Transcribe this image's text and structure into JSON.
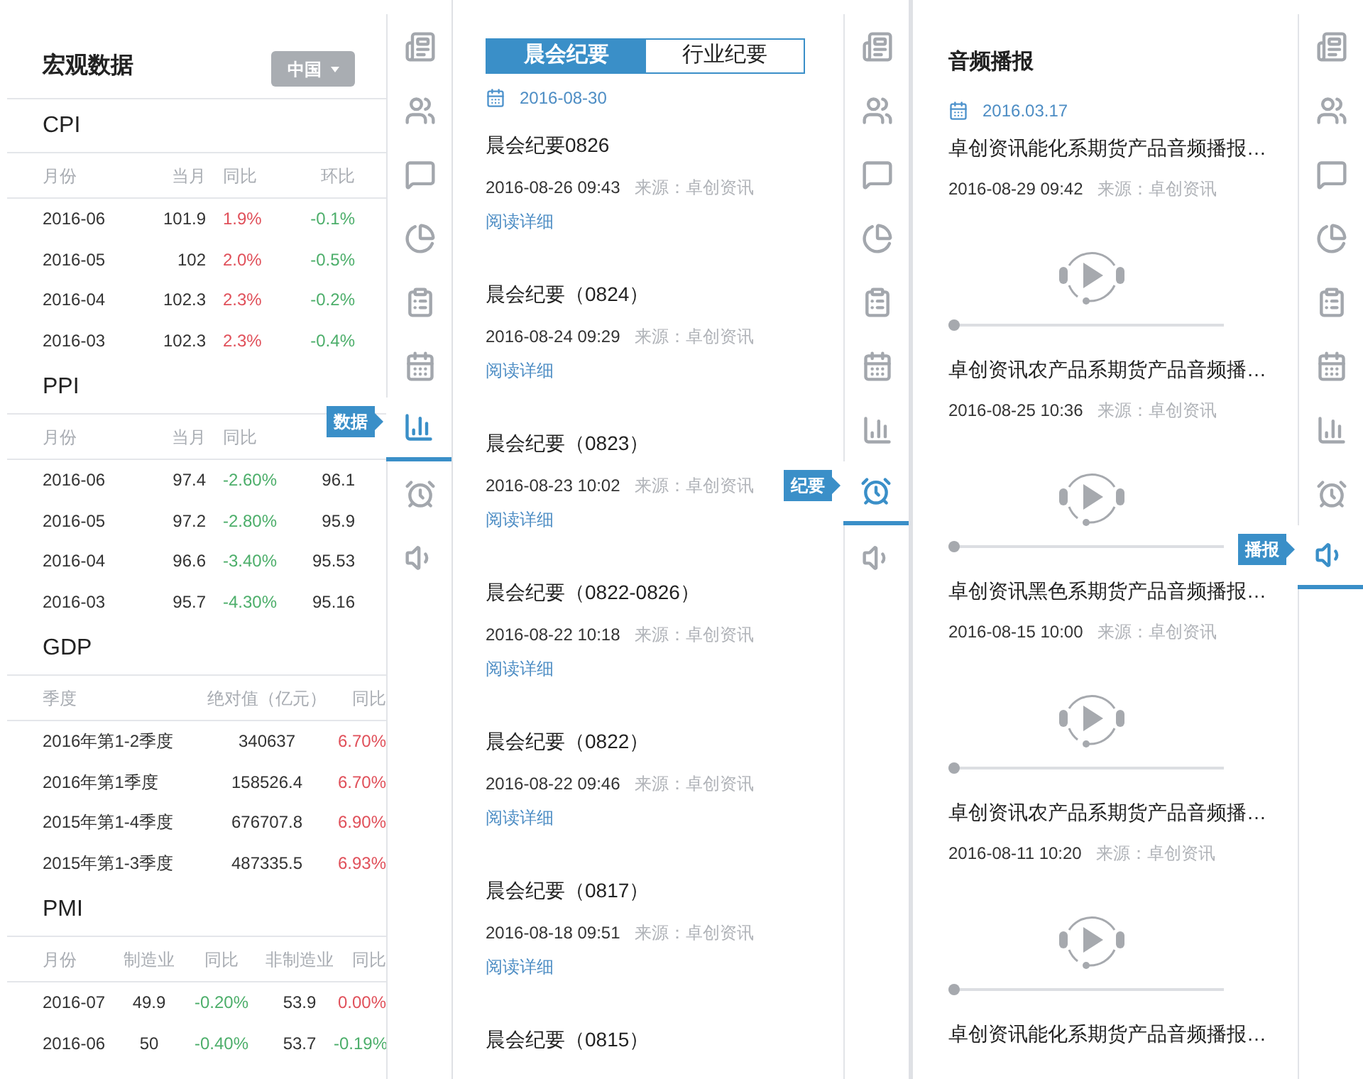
{
  "panels": [
    {
      "kind": "macro",
      "title": "宏观数据",
      "region_select": "中国",
      "sections": [
        {
          "name": "CPI",
          "columns": [
            "月份",
            "当月",
            "同比",
            "环比"
          ],
          "rows": [
            [
              "2016-06",
              "101.9",
              {
                "text": "1.9%",
                "color": "#e0505a"
              },
              {
                "text": "-0.1%",
                "color": "#4cae6a"
              }
            ],
            [
              "2016-05",
              "102",
              {
                "text": "2.0%",
                "color": "#e0505a"
              },
              {
                "text": "-0.5%",
                "color": "#4cae6a"
              }
            ],
            [
              "2016-04",
              "102.3",
              {
                "text": "2.3%",
                "color": "#e0505a"
              },
              {
                "text": "-0.2%",
                "color": "#4cae6a"
              }
            ],
            [
              "2016-03",
              "102.3",
              {
                "text": "2.3%",
                "color": "#e0505a"
              },
              {
                "text": "-0.4%",
                "color": "#4cae6a"
              }
            ]
          ]
        },
        {
          "name": "PPI",
          "columns": [
            "月份",
            "当月",
            "同比"
          ],
          "rows": [
            [
              "2016-06",
              "97.4",
              {
                "text": "-2.60%",
                "color": "#4cae6a"
              },
              "96.1"
            ],
            [
              "2016-05",
              "97.2",
              {
                "text": "-2.80%",
                "color": "#4cae6a"
              },
              "95.9"
            ],
            [
              "2016-04",
              "96.6",
              {
                "text": "-3.40%",
                "color": "#4cae6a"
              },
              "95.53"
            ],
            [
              "2016-03",
              "95.7",
              {
                "text": "-4.30%",
                "color": "#4cae6a"
              },
              "95.16"
            ]
          ]
        },
        {
          "name": "GDP",
          "columns": [
            "季度",
            "绝对值（亿元）",
            "同比"
          ],
          "rows": [
            [
              "2016年第1-2季度",
              "340637",
              {
                "text": "6.70%",
                "color": "#e0505a"
              }
            ],
            [
              "2016年第1季度",
              "158526.4",
              {
                "text": "6.70%",
                "color": "#e0505a"
              }
            ],
            [
              "2015年第1-4季度",
              "676707.8",
              {
                "text": "6.90%",
                "color": "#e0505a"
              }
            ],
            [
              "2015年第1-3季度",
              "487335.5",
              {
                "text": "6.93%",
                "color": "#e0505a"
              }
            ]
          ]
        },
        {
          "name": "PMI",
          "columns": [
            "月份",
            "制造业",
            "同比",
            "非制造业",
            "同比"
          ],
          "rows": [
            [
              "2016-07",
              "49.9",
              {
                "text": "-0.20%",
                "color": "#4cae6a"
              },
              "53.9",
              {
                "text": "0.00%",
                "color": "#e0505a"
              }
            ],
            [
              "2016-06",
              "50",
              {
                "text": "-0.40%",
                "color": "#4cae6a"
              },
              "53.7",
              {
                "text": "-0.19%",
                "color": "#4cae6a"
              }
            ]
          ]
        }
      ],
      "rail": [
        {
          "kind": "news",
          "selected": false
        },
        {
          "kind": "people",
          "selected": false
        },
        {
          "kind": "chat",
          "selected": false
        },
        {
          "kind": "pie",
          "selected": false
        },
        {
          "kind": "clipboard",
          "selected": false
        },
        {
          "kind": "calendar",
          "selected": false
        },
        {
          "kind": "bars",
          "selected": true
        },
        {
          "kind": "alarm",
          "selected": false
        },
        {
          "kind": "speaker",
          "selected": false
        }
      ],
      "callout": "数据"
    },
    {
      "kind": "minutes",
      "tabs": [
        {
          "label": "晨会纪要",
          "selected": true
        },
        {
          "label": "行业纪要",
          "selected": false
        }
      ],
      "date": "2016-08-30",
      "items": [
        {
          "title": "晨会纪要0826",
          "time": "2016-08-26 09:43",
          "source": "来源：卓创资讯",
          "link": "阅读详细"
        },
        {
          "title": "晨会纪要（0824）",
          "time": "2016-08-24 09:29",
          "source": "来源：卓创资讯",
          "link": "阅读详细"
        },
        {
          "title": "晨会纪要（0823）",
          "time": "2016-08-23 10:02",
          "source": "来源：卓创资讯",
          "link": "阅读详细"
        },
        {
          "title": "晨会纪要（0822-0826）",
          "time": "2016-08-22 10:18",
          "source": "来源：卓创资讯",
          "link": "阅读详细"
        },
        {
          "title": "晨会纪要（0822）",
          "time": "2016-08-22 09:46",
          "source": "来源：卓创资讯",
          "link": "阅读详细"
        },
        {
          "title": "晨会纪要（0817）",
          "time": "2016-08-18 09:51",
          "source": "来源：卓创资讯",
          "link": "阅读详细"
        },
        {
          "title": "晨会纪要（0815）"
        }
      ],
      "rail": [
        {
          "kind": "news",
          "selected": false
        },
        {
          "kind": "people",
          "selected": false
        },
        {
          "kind": "chat",
          "selected": false
        },
        {
          "kind": "pie",
          "selected": false
        },
        {
          "kind": "clipboard",
          "selected": false
        },
        {
          "kind": "calendar",
          "selected": false
        },
        {
          "kind": "bars",
          "selected": false
        },
        {
          "kind": "alarm",
          "selected": true
        },
        {
          "kind": "speaker",
          "selected": false
        }
      ],
      "callout": "纪要"
    },
    {
      "kind": "audio",
      "title": "音频播报",
      "date": "2016.03.17",
      "items": [
        {
          "title": "卓创资讯能化系期货产品音频播报…",
          "time": "2016-08-29 09:42",
          "source": "来源：卓创资讯",
          "level": 0
        },
        {
          "title": "卓创资讯农产品系期货产品音频播…",
          "time": "2016-08-25 10:36",
          "source": "来源：卓创资讯",
          "level": 0
        },
        {
          "title": "卓创资讯黑色系期货产品音频播报…",
          "time": "2016-08-15 10:00",
          "source": "来源：卓创资讯",
          "level": 0
        },
        {
          "title": "卓创资讯农产品系期货产品音频播…",
          "time": "2016-08-11 10:20",
          "source": "来源：卓创资讯",
          "level": 0
        },
        {
          "title": "卓创资讯能化系期货产品音频播报…"
        }
      ],
      "rail": [
        {
          "kind": "news",
          "selected": false
        },
        {
          "kind": "people",
          "selected": false
        },
        {
          "kind": "chat",
          "selected": false
        },
        {
          "kind": "pie",
          "selected": false
        },
        {
          "kind": "clipboard",
          "selected": false
        },
        {
          "kind": "calendar",
          "selected": false
        },
        {
          "kind": "bars",
          "selected": false
        },
        {
          "kind": "alarm",
          "selected": false
        },
        {
          "kind": "speaker",
          "selected": true
        }
      ],
      "callout": "播报"
    }
  ]
}
